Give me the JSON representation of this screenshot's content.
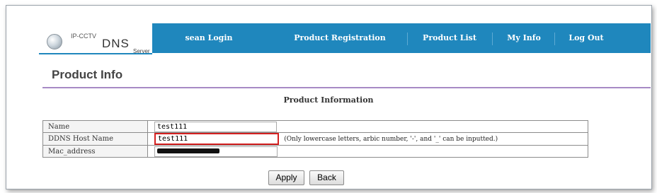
{
  "nav": {
    "logo": {
      "line1": "IP-CCTV",
      "line2": "DNS",
      "line3": "Server"
    },
    "items": [
      {
        "label": "sean Login"
      },
      {
        "label": "Product Registration"
      },
      {
        "label": "Product List"
      },
      {
        "label": "My Info"
      },
      {
        "label": "Log Out"
      }
    ]
  },
  "page": {
    "title": "Product Info",
    "section_title": "Product Information"
  },
  "form": {
    "rows": [
      {
        "label": "Name",
        "value": "test111"
      },
      {
        "label": "DDNS Host Name",
        "value": "test111",
        "hint": "(Only lowercase letters, arbic number, '-', and '_' can be inputted.)"
      },
      {
        "label": "Mac_address",
        "value": ""
      }
    ]
  },
  "buttons": {
    "apply": "Apply",
    "back": "Back"
  },
  "colors": {
    "nav_bg": "#1f87bd",
    "highlight": "#d42020",
    "rule": "#a78ac5"
  }
}
